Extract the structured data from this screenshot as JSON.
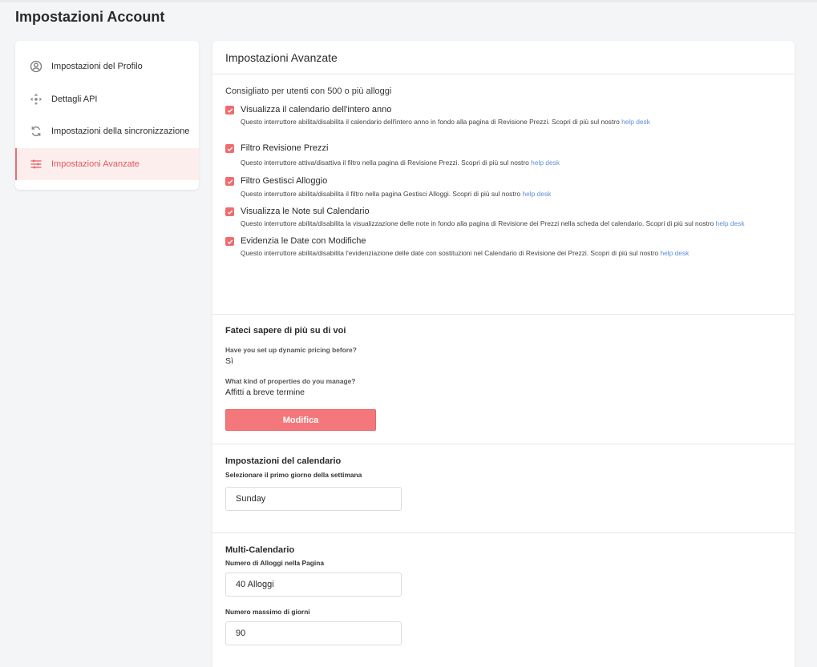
{
  "page": {
    "title": "Impostazioni Account"
  },
  "sidebar": {
    "items": [
      {
        "label": "Impostazioni del Profilo",
        "icon": "user-circle-icon",
        "active": false
      },
      {
        "label": "Dettagli API",
        "icon": "arrows-move-icon",
        "active": false
      },
      {
        "label": "Impostazioni della sincronizzazione",
        "icon": "sync-icon",
        "active": false
      },
      {
        "label": "Impostazioni Avanzate",
        "icon": "sliders-icon",
        "active": true
      }
    ]
  },
  "colors": {
    "accent": "#ee6c70",
    "accent_bg": "#fdeeee",
    "link": "#5b8fd6",
    "button": "#f4777b"
  },
  "advanced": {
    "header": "Impostazioni Avanzate",
    "subtitle": "Consigliato per utenti con 500 o più alloggi",
    "options": [
      {
        "title": "Visualizza il calendario dell'intero anno",
        "desc": "Questo interruttore abilita/disabilita il calendario dell'intero anno in fondo alla pagina di Revisione Prezzi. Scopri di più sul nostro ",
        "link": "help desk",
        "checked": true
      },
      {
        "title": "Filtro Revisione Prezzi",
        "desc": "Questo interruttore attiva/disattiva il filtro nella pagina di Revisione Prezzi. Scopri di più sul nostro ",
        "link": "help desk",
        "checked": true
      },
      {
        "title": "Filtro Gestisci Alloggio",
        "desc": "Questo interruttore abilita/disabilita il filtro nella pagina Gestisci Alloggi. Scopri di più sul nostro ",
        "link": "help desk",
        "checked": true
      },
      {
        "title": "Visualizza le Note sul Calendario",
        "desc": "Questo interruttore abilita/disabilita la visualizzazione delle note in fondo alla pagina di Revisione dei Prezzi nella scheda del calendario. Scopri di più sul nostro ",
        "link": "help desk",
        "checked": true
      },
      {
        "title": "Evidenzia le Date con Modifiche",
        "desc": "Questo interruttore abilita/disabilita l'evidenziazione delle date con sostituzioni nel Calendario di Revisione dei Prezzi. Scopri di più sul nostro ",
        "link": "help desk",
        "checked": true
      }
    ]
  },
  "about": {
    "title": "Fateci sapere di più su di voi",
    "q1_label": "Have you set up dynamic pricing before?",
    "q1_value": "Sì",
    "q2_label": "What kind of properties do you manage?",
    "q2_value": "Affitti a breve termine",
    "edit_button": "Modifica"
  },
  "calendar": {
    "title": "Impostazioni del calendario",
    "first_day_label": "Selezionare il primo giorno della settimana",
    "first_day_value": "Sunday"
  },
  "multi": {
    "title": "Multi-Calendario",
    "per_page_label": "Numero di Alloggi nella Pagina",
    "per_page_value": "40 Alloggi",
    "max_days_label": "Numero massimo di giorni",
    "max_days_value": "90"
  }
}
